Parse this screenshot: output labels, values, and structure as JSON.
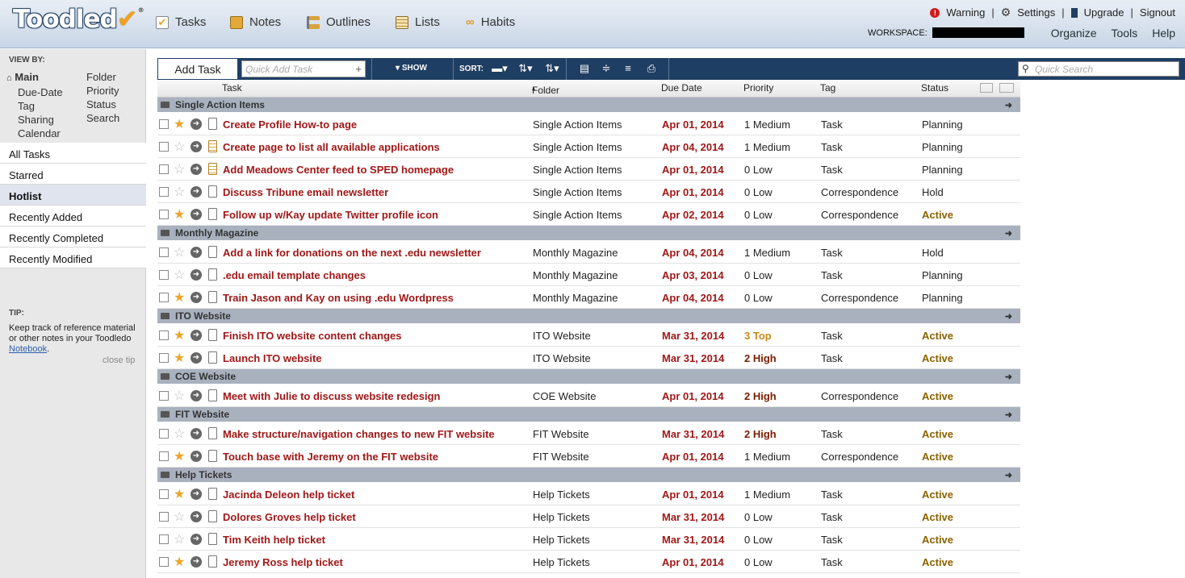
{
  "app": {
    "logo": "Toodled",
    "logo_check": "✔",
    "logo_reg": "®"
  },
  "nav": [
    {
      "label": "Tasks",
      "icon": "tasks-checkbox-icon"
    },
    {
      "label": "Notes",
      "icon": "notebook-icon"
    },
    {
      "label": "Outlines",
      "icon": "outline-tree-icon"
    },
    {
      "label": "Lists",
      "icon": "list-icon"
    },
    {
      "label": "Habits",
      "icon": "habit-link-icon"
    }
  ],
  "toplinks": {
    "warning": "Warning",
    "settings": "Settings",
    "upgrade": "Upgrade",
    "signout": "Signout",
    "sep": "|"
  },
  "workspace_label": "WORKSPACE:",
  "rightnav": {
    "organize": "Organize",
    "tools": "Tools",
    "help": "Help"
  },
  "sidebar": {
    "viewby": "VIEW BY:",
    "col1": [
      "Main",
      "Due-Date",
      "Tag",
      "Sharing",
      "Calendar"
    ],
    "col2": [
      "Folder",
      "Priority",
      "Status",
      "Search"
    ],
    "items": [
      "All Tasks",
      "Starred",
      "Hotlist",
      "Recently Added",
      "Recently Completed",
      "Recently Modified"
    ],
    "tip_label": "TIP:",
    "tip_text": "Keep track of reference material or other notes in your Toodledo ",
    "tip_link": "Notebook",
    "tip_end": ".",
    "close_tip": "close tip"
  },
  "toolbar": {
    "add_task": "Add Task",
    "quick_add_placeholder": "Quick Add Task",
    "show": "SHOW",
    "sort": "SORT:",
    "quick_search_placeholder": "Quick Search"
  },
  "columns": {
    "task": "Task",
    "folder": "Folder",
    "due": "Due Date",
    "priority": "Priority",
    "tag": "Tag",
    "status": "Status"
  },
  "groups": [
    {
      "name": "Single Action Items",
      "tasks": [
        {
          "star": true,
          "note": false,
          "name": "Create Profile How-to page",
          "folder": "Single Action Items",
          "due": "Apr 01, 2014",
          "priority": "1 Medium",
          "tag": "Task",
          "status": "Planning"
        },
        {
          "star": false,
          "note": true,
          "name": "Create page to list all available applications",
          "folder": "Single Action Items",
          "due": "Apr 04, 2014",
          "priority": "1 Medium",
          "tag": "Task",
          "status": "Planning"
        },
        {
          "star": false,
          "note": true,
          "name": "Add Meadows Center feed to SPED homepage",
          "folder": "Single Action Items",
          "due": "Apr 01, 2014",
          "priority": "0 Low",
          "tag": "Task",
          "status": "Planning"
        },
        {
          "star": false,
          "note": false,
          "name": "Discuss Tribune email newsletter",
          "folder": "Single Action Items",
          "due": "Apr 01, 2014",
          "priority": "0 Low",
          "tag": "Correspondence",
          "status": "Hold"
        },
        {
          "star": true,
          "note": false,
          "name": "Follow up w/Kay update Twitter profile icon",
          "folder": "Single Action Items",
          "due": "Apr 02, 2014",
          "priority": "0 Low",
          "tag": "Correspondence",
          "status": "Active"
        }
      ]
    },
    {
      "name": "Monthly Magazine",
      "tasks": [
        {
          "star": false,
          "note": false,
          "name": "Add a link for donations on the next .edu newsletter",
          "folder": "Monthly Magazine",
          "due": "Apr 04, 2014",
          "priority": "1 Medium",
          "tag": "Task",
          "status": "Hold"
        },
        {
          "star": false,
          "note": false,
          "name": ".edu email template changes",
          "folder": "Monthly Magazine",
          "due": "Apr 03, 2014",
          "priority": "0 Low",
          "tag": "Task",
          "status": "Planning"
        },
        {
          "star": true,
          "note": false,
          "name": "Train Jason and Kay on using .edu Wordpress",
          "folder": "Monthly Magazine",
          "due": "Apr 04, 2014",
          "priority": "0 Low",
          "tag": "Correspondence",
          "status": "Planning"
        }
      ]
    },
    {
      "name": "ITO Website",
      "tasks": [
        {
          "star": true,
          "note": false,
          "name": "Finish ITO website content changes",
          "folder": "ITO Website",
          "due": "Mar 31, 2014",
          "priority": "3 Top",
          "tag": "Task",
          "status": "Active"
        },
        {
          "star": true,
          "note": false,
          "name": "Launch ITO website",
          "folder": "ITO Website",
          "due": "Mar 31, 2014",
          "priority": "2 High",
          "tag": "Task",
          "status": "Active"
        }
      ]
    },
    {
      "name": "COE Website",
      "tasks": [
        {
          "star": false,
          "note": false,
          "name": "Meet with Julie to discuss website redesign",
          "folder": "COE Website",
          "due": "Apr 01, 2014",
          "priority": "2 High",
          "tag": "Correspondence",
          "status": "Active"
        }
      ]
    },
    {
      "name": "FIT Website",
      "tasks": [
        {
          "star": false,
          "note": false,
          "name": "Make structure/navigation changes to new FIT website",
          "folder": "FIT Website",
          "due": "Mar 31, 2014",
          "priority": "2 High",
          "tag": "Task",
          "status": "Active"
        },
        {
          "star": true,
          "note": false,
          "name": "Touch base with Jeremy on the FIT website",
          "folder": "FIT Website",
          "due": "Apr 01, 2014",
          "priority": "1 Medium",
          "tag": "Correspondence",
          "status": "Active"
        }
      ]
    },
    {
      "name": "Help Tickets",
      "tasks": [
        {
          "star": true,
          "note": false,
          "name": "Jacinda Deleon help ticket",
          "folder": "Help Tickets",
          "due": "Apr 01, 2014",
          "priority": "1 Medium",
          "tag": "Task",
          "status": "Active"
        },
        {
          "star": false,
          "note": false,
          "name": "Dolores Groves help ticket",
          "folder": "Help Tickets",
          "due": "Mar 31, 2014",
          "priority": "0 Low",
          "tag": "Task",
          "status": "Active"
        },
        {
          "star": false,
          "note": false,
          "name": "Tim Keith help ticket",
          "folder": "Help Tickets",
          "due": "Mar 31, 2014",
          "priority": "0 Low",
          "tag": "Task",
          "status": "Active"
        },
        {
          "star": true,
          "note": false,
          "name": "Jeremy Ross help ticket",
          "folder": "Help Tickets",
          "due": "Apr 01, 2014",
          "priority": "0 Low",
          "tag": "Task",
          "status": "Active"
        }
      ]
    }
  ]
}
